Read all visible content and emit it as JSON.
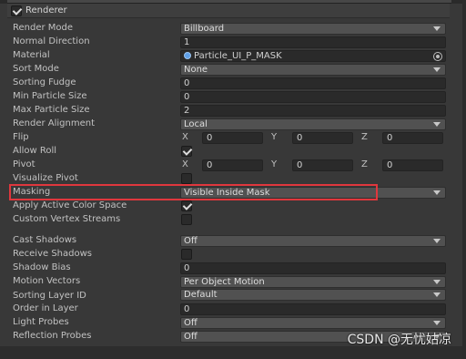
{
  "header": {
    "title": "Renderer",
    "enabled": true
  },
  "properties": {
    "render_mode": {
      "label": "Render Mode",
      "value": "Billboard"
    },
    "normal_direction": {
      "label": "Normal Direction",
      "value": "1"
    },
    "material": {
      "label": "Material",
      "value": "Particle_UI_P_MASK"
    },
    "sort_mode": {
      "label": "Sort Mode",
      "value": "None"
    },
    "sorting_fudge": {
      "label": "Sorting Fudge",
      "value": "0"
    },
    "min_particle_size": {
      "label": "Min Particle Size",
      "value": "0"
    },
    "max_particle_size": {
      "label": "Max Particle Size",
      "value": "2"
    },
    "render_alignment": {
      "label": "Render Alignment",
      "value": "Local"
    },
    "flip": {
      "label": "Flip",
      "x": "0",
      "y": "0",
      "z": "0"
    },
    "allow_roll": {
      "label": "Allow Roll",
      "checked": true
    },
    "pivot": {
      "label": "Pivot",
      "x": "0",
      "y": "0",
      "z": "0"
    },
    "visualize_pivot": {
      "label": "Visualize Pivot",
      "checked": false
    },
    "masking": {
      "label": "Masking",
      "value": "Visible Inside Mask"
    },
    "apply_active_color_space": {
      "label": "Apply Active Color Space",
      "checked": true
    },
    "custom_vertex_streams": {
      "label": "Custom Vertex Streams",
      "checked": false
    },
    "cast_shadows": {
      "label": "Cast Shadows",
      "value": "Off"
    },
    "receive_shadows": {
      "label": "Receive Shadows",
      "checked": false
    },
    "shadow_bias": {
      "label": "Shadow Bias",
      "value": "0"
    },
    "motion_vectors": {
      "label": "Motion Vectors",
      "value": "Per Object Motion"
    },
    "sorting_layer_id": {
      "label": "Sorting Layer ID",
      "value": "Default"
    },
    "order_in_layer": {
      "label": "Order in Layer",
      "value": "0"
    },
    "light_probes": {
      "label": "Light Probes",
      "value": "Off"
    },
    "reflection_probes": {
      "label": "Reflection Probes",
      "value": "Off"
    }
  },
  "axis_labels": {
    "x": "X",
    "y": "Y",
    "z": "Z"
  },
  "watermark": "CSDN @无忧姑凉",
  "colors": {
    "highlight": "#e0373d",
    "panel_bg": "#383838",
    "field_bg": "#2a2a2a",
    "dropdown_bg": "#515151"
  }
}
